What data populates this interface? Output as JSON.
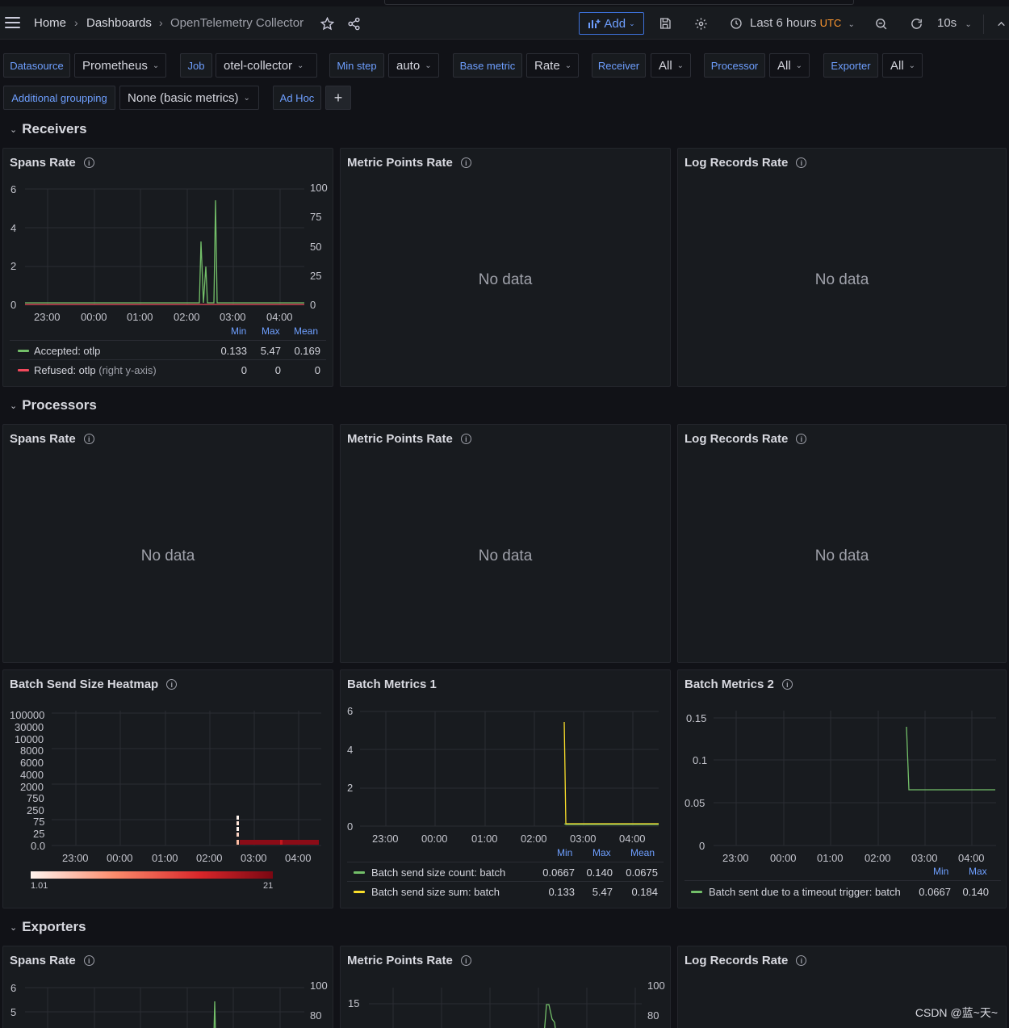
{
  "nav": {
    "home": "Home",
    "dashboards": "Dashboards",
    "current": "OpenTelemetry Collector",
    "add_label": "Add",
    "time_range": "Last 6 hours",
    "timezone": "UTC",
    "refresh": "10s"
  },
  "variables": [
    {
      "label": "Datasource",
      "value": "Prometheus"
    },
    {
      "label": "Job",
      "value": "otel-collector"
    },
    {
      "label": "Min step",
      "value": "auto"
    },
    {
      "label": "Base metric",
      "value": "Rate"
    },
    {
      "label": "Receiver",
      "value": "All"
    },
    {
      "label": "Processor",
      "value": "All"
    },
    {
      "label": "Exporter",
      "value": "All"
    },
    {
      "label": "Additional groupping",
      "value": "None (basic metrics)"
    },
    {
      "label": "Ad Hoc",
      "value": "+"
    }
  ],
  "rows": {
    "receivers": "Receivers",
    "processors": "Processors",
    "exporters": "Exporters"
  },
  "panels": {
    "spans_rate": "Spans Rate",
    "metric_points_rate": "Metric Points Rate",
    "log_records_rate": "Log Records Rate",
    "heatmap": "Batch Send Size Heatmap",
    "batch1": "Batch Metrics 1",
    "batch2": "Batch Metrics 2",
    "no_data": "No data"
  },
  "time_ticks": [
    "23:00",
    "00:00",
    "01:00",
    "02:00",
    "03:00",
    "04:00"
  ],
  "legend_headers": {
    "min": "Min",
    "max": "Max",
    "mean": "Mean"
  },
  "receivers_spans": {
    "y_left": [
      "6",
      "4",
      "2",
      "0"
    ],
    "y_right": [
      "100",
      "75",
      "50",
      "25",
      "0"
    ],
    "series": [
      {
        "name": "Accepted: otlp",
        "min": "0.133",
        "max": "5.47",
        "mean": "0.169",
        "color": "#73bf69"
      },
      {
        "name": "Refused: otlp",
        "suffix": "(right y-axis)",
        "min": "0",
        "max": "0",
        "mean": "0",
        "color": "#f2495c"
      }
    ]
  },
  "heatmap": {
    "y_ticks": [
      "100000",
      "30000",
      "10000",
      "8000",
      "6000",
      "4000",
      "2000",
      "750",
      "250",
      "75",
      "25",
      "0.0"
    ],
    "scale_min": "1.01",
    "scale_max": "21"
  },
  "batch1": {
    "y_ticks": [
      "6",
      "4",
      "2",
      "0"
    ],
    "series": [
      {
        "name": "Batch send size count: batch",
        "min": "0.0667",
        "max": "0.140",
        "mean": "0.0675",
        "color": "#73bf69"
      },
      {
        "name": "Batch send size sum: batch",
        "min": "0.133",
        "max": "5.47",
        "mean": "0.184",
        "color": "#fade2a"
      }
    ]
  },
  "batch2": {
    "y_ticks": [
      "0.15",
      "0.1",
      "0.05",
      "0"
    ],
    "series": [
      {
        "name": "Batch sent due to a timeout trigger: batch",
        "min": "0.0667",
        "max": "0.140",
        "color": "#73bf69"
      }
    ]
  },
  "exporters_spans": {
    "y_left": [
      "6",
      "5"
    ],
    "y_right": [
      "100",
      "80"
    ]
  },
  "exporters_metrics": {
    "y_left": [
      "15"
    ],
    "y_right": [
      "100",
      "80"
    ]
  },
  "chart_data": [
    {
      "type": "line",
      "title": "Spans Rate",
      "x": [
        "22:30",
        "23:00",
        "00:00",
        "01:00",
        "02:00",
        "02:20",
        "02:25",
        "02:35",
        "02:40",
        "03:00",
        "04:00",
        "04:30"
      ],
      "series": [
        {
          "name": "Accepted: otlp",
          "values": [
            0.133,
            0.133,
            0.133,
            0.133,
            0.133,
            3.3,
            2.0,
            5.47,
            0.133,
            0.133,
            0.133,
            0.133
          ]
        },
        {
          "name": "Refused: otlp",
          "values": [
            0,
            0,
            0,
            0,
            0,
            0,
            0,
            0,
            0,
            0,
            0,
            0
          ]
        }
      ],
      "ylim": [
        0,
        6
      ],
      "y2lim": [
        0,
        100
      ]
    },
    {
      "type": "line",
      "title": "Batch Metrics 1",
      "x": [
        "22:30",
        "02:35",
        "02:40",
        "03:00",
        "04:00",
        "04:30"
      ],
      "series": [
        {
          "name": "Batch send size count: batch",
          "values": [
            null,
            0.14,
            0.0667,
            0.0667,
            0.0667,
            0.0667
          ]
        },
        {
          "name": "Batch send size sum: batch",
          "values": [
            null,
            5.47,
            0.133,
            0.133,
            0.133,
            0.133
          ]
        }
      ],
      "ylim": [
        0,
        6
      ]
    },
    {
      "type": "line",
      "title": "Batch Metrics 2",
      "x": [
        "22:30",
        "02:35",
        "02:40",
        "03:00",
        "04:00",
        "04:30"
      ],
      "series": [
        {
          "name": "Batch sent due to a timeout trigger: batch",
          "values": [
            null,
            0.14,
            0.0667,
            0.0667,
            0.0667,
            0.0667
          ]
        }
      ],
      "ylim": [
        0,
        0.15
      ]
    },
    {
      "type": "heatmap",
      "title": "Batch Send Size Heatmap",
      "range": [
        1.01,
        21
      ]
    }
  ],
  "watermark": "CSDN @蓝~天~"
}
